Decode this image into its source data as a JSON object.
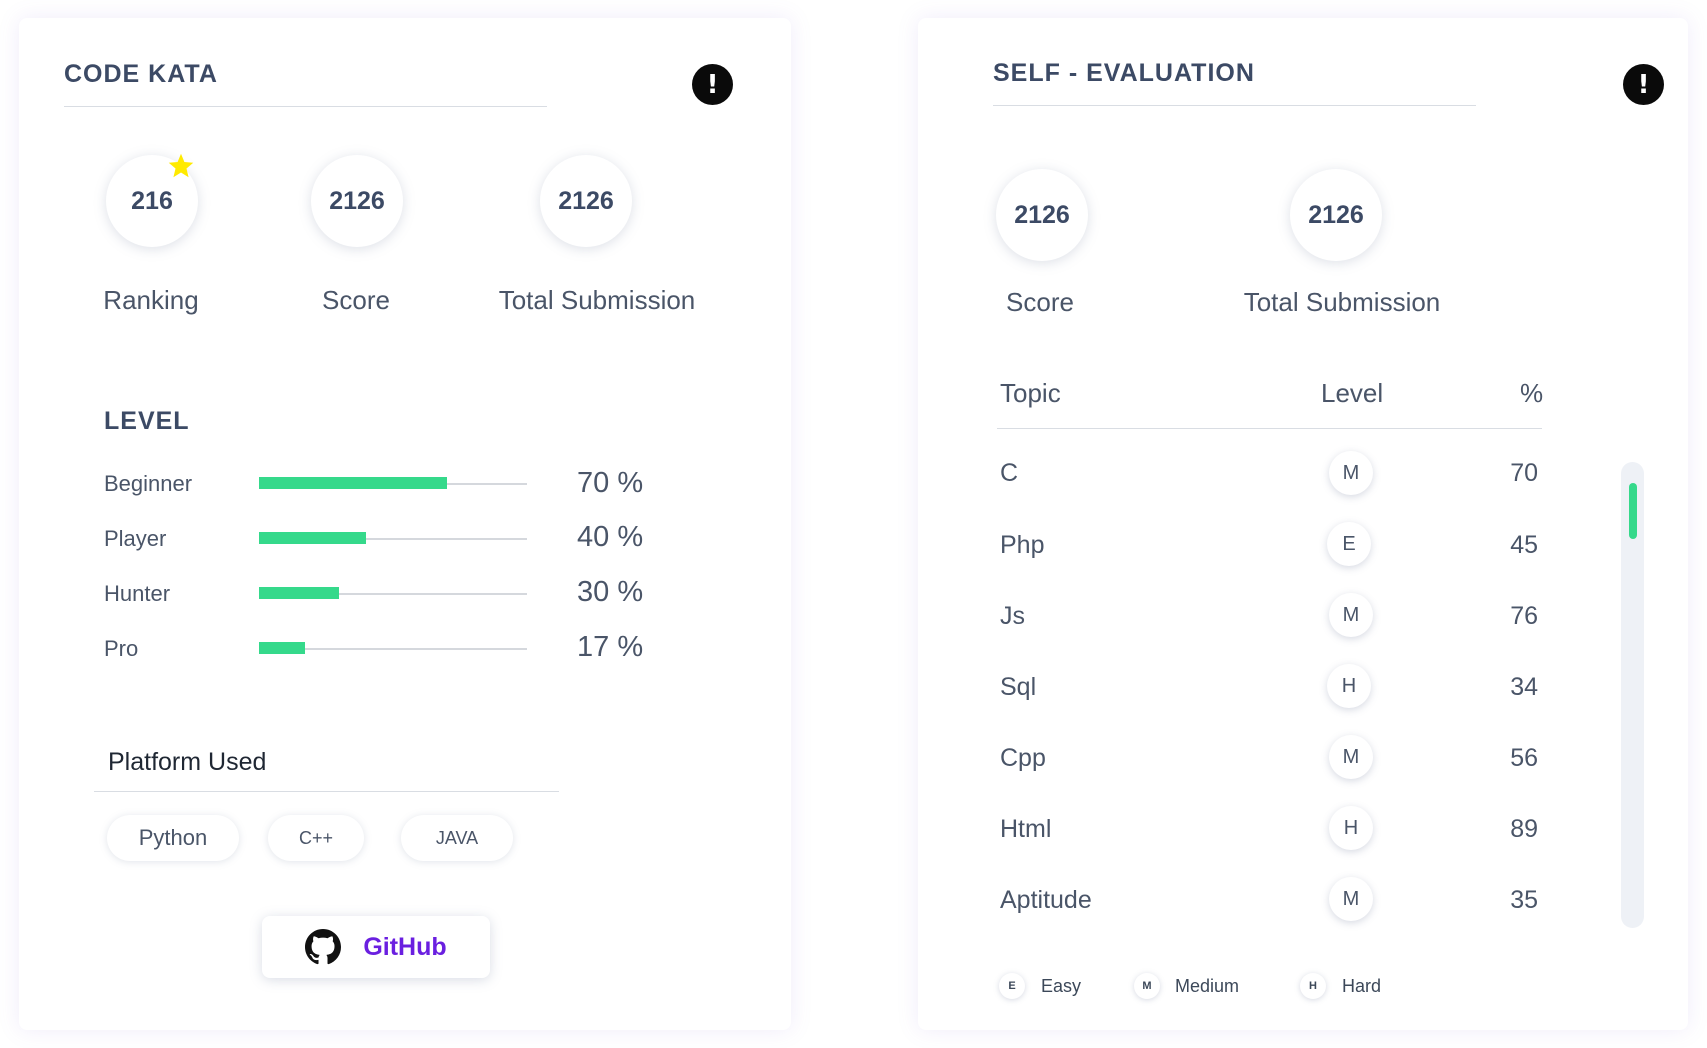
{
  "code_kata": {
    "title": "CODE KATA",
    "info_icon": "exclamation-icon",
    "stats": [
      {
        "value": "216",
        "label": "Ranking"
      },
      {
        "value": "2126",
        "label": "Score"
      },
      {
        "value": "2126",
        "label": "Total Submission"
      }
    ],
    "star_color": "#ffea00",
    "level": {
      "title": "LEVEL",
      "items": [
        {
          "name": "Beginner",
          "percent": 70,
          "text": "70 %"
        },
        {
          "name": "Player",
          "percent": 40,
          "text": "40 %"
        },
        {
          "name": "Hunter",
          "percent": 30,
          "text": "30 %"
        },
        {
          "name": "Pro",
          "percent": 17,
          "text": "17 %"
        }
      ],
      "bar_color": "#35d98b"
    },
    "platform": {
      "title": "Platform Used",
      "chips": [
        "Python",
        "C++",
        "JAVA"
      ]
    },
    "github": {
      "label": "GitHub",
      "icon": "github-icon",
      "color": "#6a1fe0"
    }
  },
  "self_evaluation": {
    "title": "SELF - EVALUATION",
    "info_icon": "exclamation-icon",
    "stats": [
      {
        "value": "2126",
        "label": "Score"
      },
      {
        "value": "2126",
        "label": "Total Submission"
      }
    ],
    "table": {
      "headers": {
        "topic": "Topic",
        "level": "Level",
        "percent": "%"
      },
      "rows": [
        {
          "topic": "C",
          "level": "M",
          "percent": "70"
        },
        {
          "topic": "Php",
          "level": "E",
          "percent": "45"
        },
        {
          "topic": "Js",
          "level": "M",
          "percent": "76"
        },
        {
          "topic": "Sql",
          "level": "H",
          "percent": "34"
        },
        {
          "topic": "Cpp",
          "level": "M",
          "percent": "56"
        },
        {
          "topic": "Html",
          "level": "H",
          "percent": "89"
        },
        {
          "topic": "Aptitude",
          "level": "M",
          "percent": "35"
        }
      ]
    },
    "legend": [
      {
        "badge": "E",
        "label": "Easy"
      },
      {
        "badge": "M",
        "label": "Medium"
      },
      {
        "badge": "H",
        "label": "Hard"
      }
    ],
    "scrollbar_color": "#35d98b"
  }
}
